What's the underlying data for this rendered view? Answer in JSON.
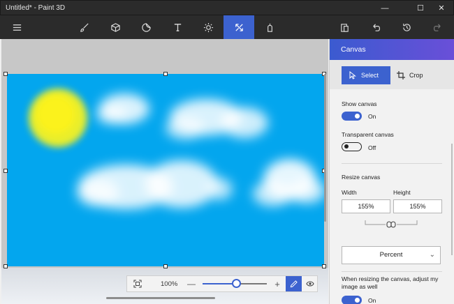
{
  "window": {
    "title": "Untitled* - Paint 3D"
  },
  "colors": {
    "titlebar": "#2b2b2b",
    "accent": "#3c62cf",
    "canvas_sky": "#03a6ee",
    "sun": "#f2ea18"
  },
  "toolbar": {
    "items": [
      {
        "name": "brushes",
        "icon": "brush-icon"
      },
      {
        "name": "3d-shapes",
        "icon": "cube-icon"
      },
      {
        "name": "stickers",
        "icon": "sticker-icon"
      },
      {
        "name": "text",
        "icon": "text-icon"
      },
      {
        "name": "effects",
        "icon": "sun-effects-icon"
      },
      {
        "name": "canvas",
        "icon": "canvas-resize-icon",
        "active": true
      },
      {
        "name": "3d-library",
        "icon": "library-icon"
      }
    ],
    "right": [
      "paste-icon",
      "undo-icon",
      "history-icon",
      "redo-icon"
    ]
  },
  "zoom": {
    "value": "100%",
    "level_fraction": 0.52
  },
  "panel": {
    "title": "Canvas",
    "select_label": "Select",
    "crop_label": "Crop",
    "show_canvas": {
      "label": "Show canvas",
      "state": "On"
    },
    "transparent_canvas": {
      "label": "Transparent canvas",
      "state": "Off"
    },
    "resize": {
      "label": "Resize canvas",
      "width_label": "Width",
      "height_label": "Height",
      "width_value": "155%",
      "height_value": "155%"
    },
    "unit": "Percent",
    "adjust_note": "When resizing the canvas, adjust my image as well",
    "adjust_state": "On"
  }
}
